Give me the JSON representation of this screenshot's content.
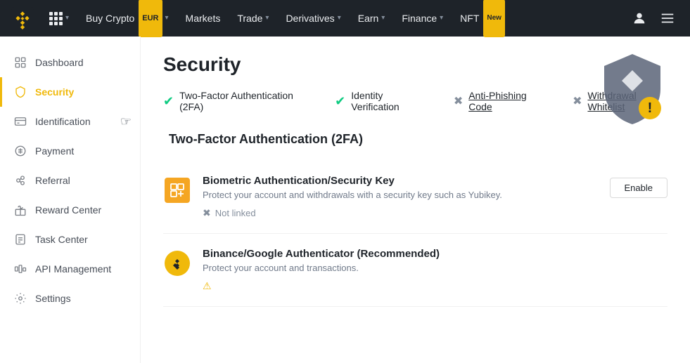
{
  "brand": {
    "name": "Binance"
  },
  "topnav": {
    "items": [
      {
        "label": "Buy Crypto",
        "badge": "EUR",
        "has_chevron": true
      },
      {
        "label": "Markets",
        "has_chevron": false
      },
      {
        "label": "Trade",
        "has_chevron": true
      },
      {
        "label": "Derivatives",
        "has_chevron": true
      },
      {
        "label": "Earn",
        "has_chevron": true
      },
      {
        "label": "Finance",
        "has_chevron": true
      },
      {
        "label": "NFT",
        "badge": "New",
        "has_chevron": false
      }
    ]
  },
  "sidebar": {
    "items": [
      {
        "id": "dashboard",
        "label": "Dashboard",
        "active": false
      },
      {
        "id": "security",
        "label": "Security",
        "active": true
      },
      {
        "id": "identification",
        "label": "Identification",
        "active": false
      },
      {
        "id": "payment",
        "label": "Payment",
        "active": false
      },
      {
        "id": "referral",
        "label": "Referral",
        "active": false
      },
      {
        "id": "reward-center",
        "label": "Reward Center",
        "active": false
      },
      {
        "id": "task-center",
        "label": "Task Center",
        "active": false
      },
      {
        "id": "api-management",
        "label": "API Management",
        "active": false
      },
      {
        "id": "settings",
        "label": "Settings",
        "active": false
      }
    ]
  },
  "page": {
    "title": "Security",
    "status_items": [
      {
        "label": "Two-Factor Authentication (2FA)",
        "type": "check"
      },
      {
        "label": "Identity Verification",
        "type": "check"
      },
      {
        "label": "Anti-Phishing Code",
        "type": "x",
        "is_link": true
      },
      {
        "label": "Withdrawal Whitelist",
        "type": "x",
        "is_link": true
      }
    ],
    "section_2fa_title": "Two-Factor Authentication (2FA)",
    "auth_items": [
      {
        "id": "biometric",
        "title": "Biometric Authentication/Security Key",
        "description": "Protect your account and withdrawals with a security key such as Yubikey.",
        "status_label": "Not linked",
        "status_type": "x",
        "action_label": "Enable"
      },
      {
        "id": "google-auth",
        "title": "Binance/Google Authenticator (Recommended)",
        "description": "Protect your account and transactions.",
        "status_label": "",
        "status_type": "warn",
        "action_label": null
      }
    ]
  }
}
